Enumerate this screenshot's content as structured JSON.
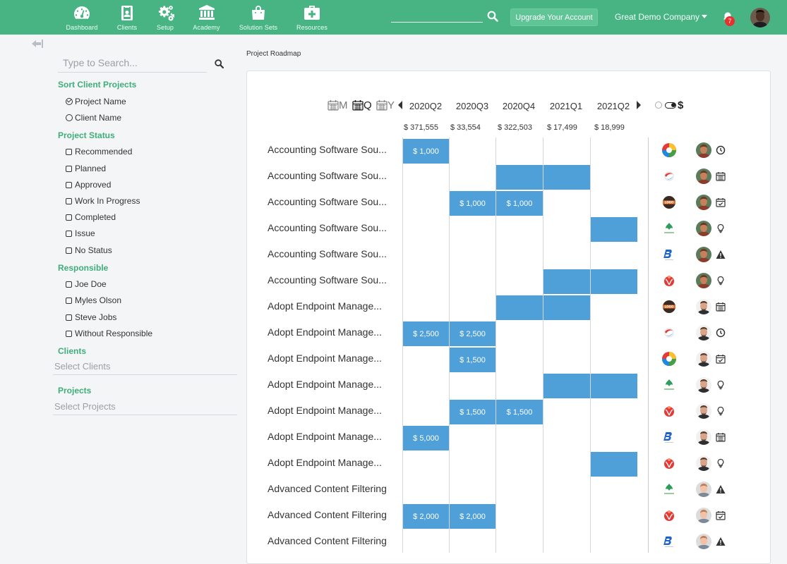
{
  "nav": [
    {
      "label": "Dashboard",
      "icon": "dashboard-icon"
    },
    {
      "label": "Clients",
      "icon": "clients-icon"
    },
    {
      "label": "Setup",
      "icon": "gears-icon"
    },
    {
      "label": "Academy",
      "icon": "academy-icon"
    },
    {
      "label": "Solution Sets",
      "icon": "shopping-bag-icon"
    },
    {
      "label": "Resources",
      "icon": "medkit-icon"
    }
  ],
  "header": {
    "search_value": "",
    "upgrade_label": "Upgrade Your Account",
    "company": "Great Demo Company",
    "notifications": "7"
  },
  "sidebar": {
    "search_placeholder": "Type to Search...",
    "sort_title": "Sort Client Projects",
    "sort_options": [
      {
        "label": "Project Name",
        "selected": true
      },
      {
        "label": "Client Name",
        "selected": false
      }
    ],
    "status_title": "Project Status",
    "status_options": [
      "Recommended",
      "Planned",
      "Approved",
      "Work In Progress",
      "Completed",
      "Issue",
      "No Status"
    ],
    "responsible_title": "Responsible",
    "responsible_options": [
      "Joe Doe",
      "Myles Olson",
      "Steve Jobs",
      "Without Responsible"
    ],
    "clients_title": "Clients",
    "clients_placeholder": "Select Clients",
    "projects_title": "Projects",
    "projects_placeholder": "Select Projects"
  },
  "main": {
    "page_title": "Project Roadmap",
    "view_buttons": [
      {
        "label": "M",
        "active": false
      },
      {
        "label": "Q",
        "active": true
      },
      {
        "label": "Y",
        "active": false
      }
    ],
    "quarters": [
      "2020Q2",
      "2020Q3",
      "2020Q4",
      "2021Q1",
      "2021Q2"
    ],
    "totals": [
      "$ 371,555",
      "$ 33,554",
      "$ 322,503",
      "$ 17,499",
      "$ 18,999"
    ],
    "currency_symbol": "$",
    "bar_color": "#4f9fd9",
    "rows": [
      {
        "name": "Accounting Software Sou...",
        "logo": "rainbow",
        "person": "myles",
        "status": "clock",
        "bars": [
          {
            "q": 0,
            "span": 1,
            "label": "$ 1,000"
          }
        ]
      },
      {
        "name": "Accounting Software Sou...",
        "logo": "swoosh",
        "person": "myles",
        "status": "calendar",
        "bars": [
          {
            "q": 2,
            "span": 1,
            "label": ""
          },
          {
            "q": 3,
            "span": 1,
            "label": ""
          }
        ]
      },
      {
        "name": "Accounting Software Sou...",
        "logo": "badge",
        "person": "myles",
        "status": "calendar-check",
        "bars": [
          {
            "q": 1,
            "span": 1,
            "label": "$ 1,000"
          },
          {
            "q": 2,
            "span": 1,
            "label": "$ 1,000"
          }
        ]
      },
      {
        "name": "Accounting Software Sou...",
        "logo": "leaf",
        "person": "myles",
        "status": "bulb",
        "bars": [
          {
            "q": 4,
            "span": 1,
            "label": ""
          }
        ]
      },
      {
        "name": "Accounting Software Sou...",
        "logo": "b-mark",
        "person": "myles",
        "status": "warning",
        "bars": []
      },
      {
        "name": "Accounting Software Sou...",
        "logo": "bird",
        "person": "myles",
        "status": "bulb",
        "bars": [
          {
            "q": 3,
            "span": 1,
            "label": ""
          },
          {
            "q": 4,
            "span": 1,
            "label": ""
          }
        ]
      },
      {
        "name": "Adopt Endpoint Manage...",
        "logo": "badge",
        "person": "steve",
        "status": "calendar",
        "bars": [
          {
            "q": 2,
            "span": 1,
            "label": ""
          },
          {
            "q": 3,
            "span": 1,
            "label": ""
          }
        ]
      },
      {
        "name": "Adopt Endpoint Manage...",
        "logo": "swoosh",
        "person": "steve",
        "status": "clock",
        "bars": [
          {
            "q": 0,
            "span": 1,
            "label": "$ 2,500"
          },
          {
            "q": 1,
            "span": 1,
            "label": "$ 2,500"
          }
        ]
      },
      {
        "name": "Adopt Endpoint Manage...",
        "logo": "rainbow",
        "person": "steve",
        "status": "calendar-check",
        "bars": [
          {
            "q": 1,
            "span": 1,
            "label": "$ 1,500"
          }
        ]
      },
      {
        "name": "Adopt Endpoint Manage...",
        "logo": "leaf",
        "person": "steve",
        "status": "bulb",
        "bars": [
          {
            "q": 3,
            "span": 1,
            "label": ""
          },
          {
            "q": 4,
            "span": 1,
            "label": ""
          }
        ]
      },
      {
        "name": "Adopt Endpoint Manage...",
        "logo": "bird",
        "person": "steve",
        "status": "bulb",
        "bars": [
          {
            "q": 1,
            "span": 1,
            "label": "$ 1,500"
          },
          {
            "q": 2,
            "span": 1,
            "label": "$ 1,500"
          }
        ]
      },
      {
        "name": "Adopt Endpoint Manage...",
        "logo": "b-mark",
        "person": "steve",
        "status": "calendar",
        "bars": [
          {
            "q": 0,
            "span": 1,
            "label": "$ 5,000"
          }
        ]
      },
      {
        "name": "Adopt Endpoint Manage...",
        "logo": "bird",
        "person": "steve",
        "status": "bulb",
        "bars": [
          {
            "q": 4,
            "span": 1,
            "label": ""
          }
        ]
      },
      {
        "name": "Advanced Content Filtering",
        "logo": "leaf",
        "person": "joe",
        "status": "warning",
        "bars": []
      },
      {
        "name": "Advanced Content Filtering",
        "logo": "bird",
        "person": "joe",
        "status": "calendar-check",
        "bars": [
          {
            "q": 0,
            "span": 1,
            "label": "$ 2,000"
          },
          {
            "q": 1,
            "span": 1,
            "label": "$ 2,000"
          }
        ]
      },
      {
        "name": "Advanced Content Filtering",
        "logo": "b-mark",
        "person": "joe",
        "status": "warning",
        "bars": []
      }
    ]
  }
}
